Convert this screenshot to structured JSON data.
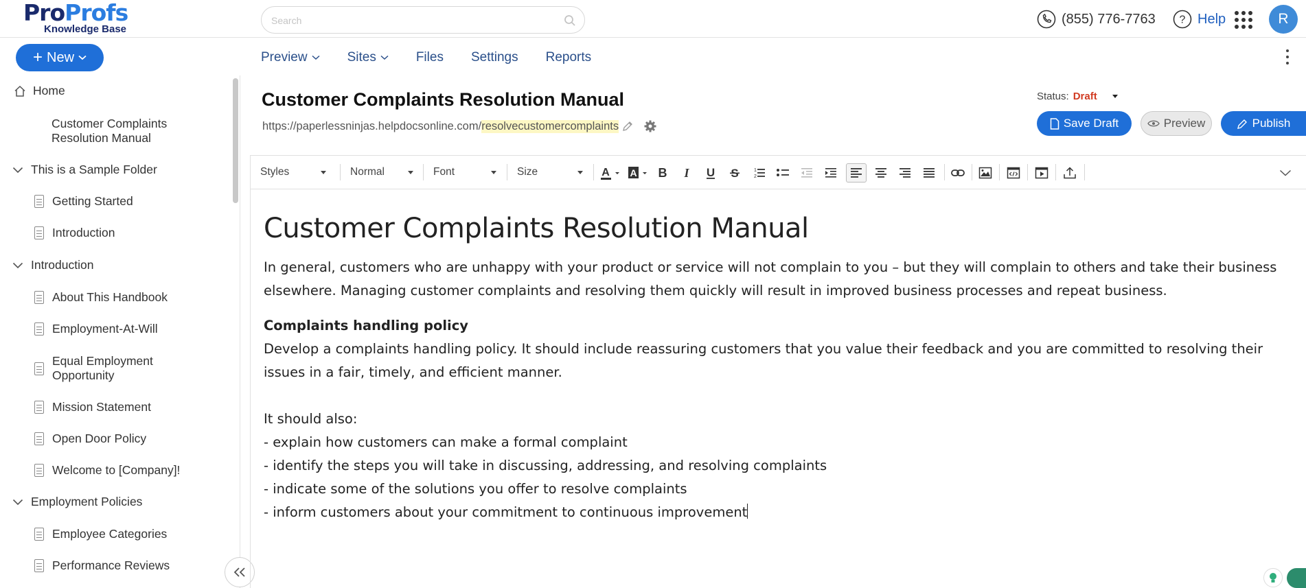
{
  "brand": {
    "logo_part1": "Pro",
    "logo_part2": "Profs",
    "logo_sub": "Knowledge Base"
  },
  "search": {
    "placeholder": "Search"
  },
  "header": {
    "phone": "(855) 776-7763",
    "help": "Help",
    "avatar_initial": "R"
  },
  "new_button": {
    "label": "New",
    "plus": "+"
  },
  "topnav": {
    "items": [
      {
        "label": "Preview",
        "has_caret": true
      },
      {
        "label": "Sites",
        "has_caret": true
      },
      {
        "label": "Files",
        "has_caret": false
      },
      {
        "label": "Settings",
        "has_caret": false
      },
      {
        "label": "Reports",
        "has_caret": false
      }
    ]
  },
  "sidebar": {
    "items": [
      {
        "label": "Home",
        "type": "home"
      },
      {
        "label": "Customer Complaints Resolution Manual",
        "type": "page"
      },
      {
        "label": "This is a Sample Folder",
        "type": "folder"
      },
      {
        "label": "Getting Started",
        "type": "doc"
      },
      {
        "label": "Introduction",
        "type": "doc"
      },
      {
        "label": "Introduction",
        "type": "folder"
      },
      {
        "label": "About This Handbook",
        "type": "doc"
      },
      {
        "label": "Employment-At-Will",
        "type": "doc"
      },
      {
        "label": "Equal Employment Opportunity",
        "type": "doc"
      },
      {
        "label": "Mission Statement",
        "type": "doc"
      },
      {
        "label": "Open Door Policy",
        "type": "doc"
      },
      {
        "label": "Welcome to [Company]!",
        "type": "doc"
      },
      {
        "label": "Employment Policies",
        "type": "folder"
      },
      {
        "label": "Employee Categories",
        "type": "doc"
      },
      {
        "label": "Performance Reviews",
        "type": "doc"
      }
    ]
  },
  "article": {
    "title": "Customer Complaints Resolution Manual",
    "url_base": "https://paperlessninjas.helpdocsonline.com/",
    "url_slug": "resolvecustomercomplaints"
  },
  "status": {
    "label": "Status:",
    "value": "Draft"
  },
  "actions": {
    "save_draft": "Save Draft",
    "preview": "Preview",
    "publish": "Publish"
  },
  "toolbar": {
    "styles": "Styles",
    "format": "Normal",
    "font": "Font",
    "size": "Size"
  },
  "content": {
    "heading": "Customer Complaints Resolution Manual",
    "intro_line1": "In general, customers who are unhappy with your product or service will not complain to you – but they will complain to others and take their business",
    "intro_line2": "elsewhere. Managing customer complaints and resolving them quickly will result in improved business processes and repeat business.",
    "policy_heading": "Complaints handling policy",
    "policy_line1": "Develop a complaints handling policy. It should include reassuring customers that you value their feedback and you are committed to resolving their",
    "policy_line2": "issues in a fair, timely, and efficient manner.",
    "also": "It should also:",
    "bullets": [
      "- explain how customers can make a formal complaint",
      "- identify the steps you will take in discussing, addressing, and resolving complaints",
      "- indicate some of the solutions you offer to resolve complaints",
      "- inform customers about your commitment to continuous improvement"
    ]
  },
  "colors": {
    "accent": "#1f6fd8",
    "draft": "#d13b22",
    "nav_text": "#2a4f8a"
  }
}
